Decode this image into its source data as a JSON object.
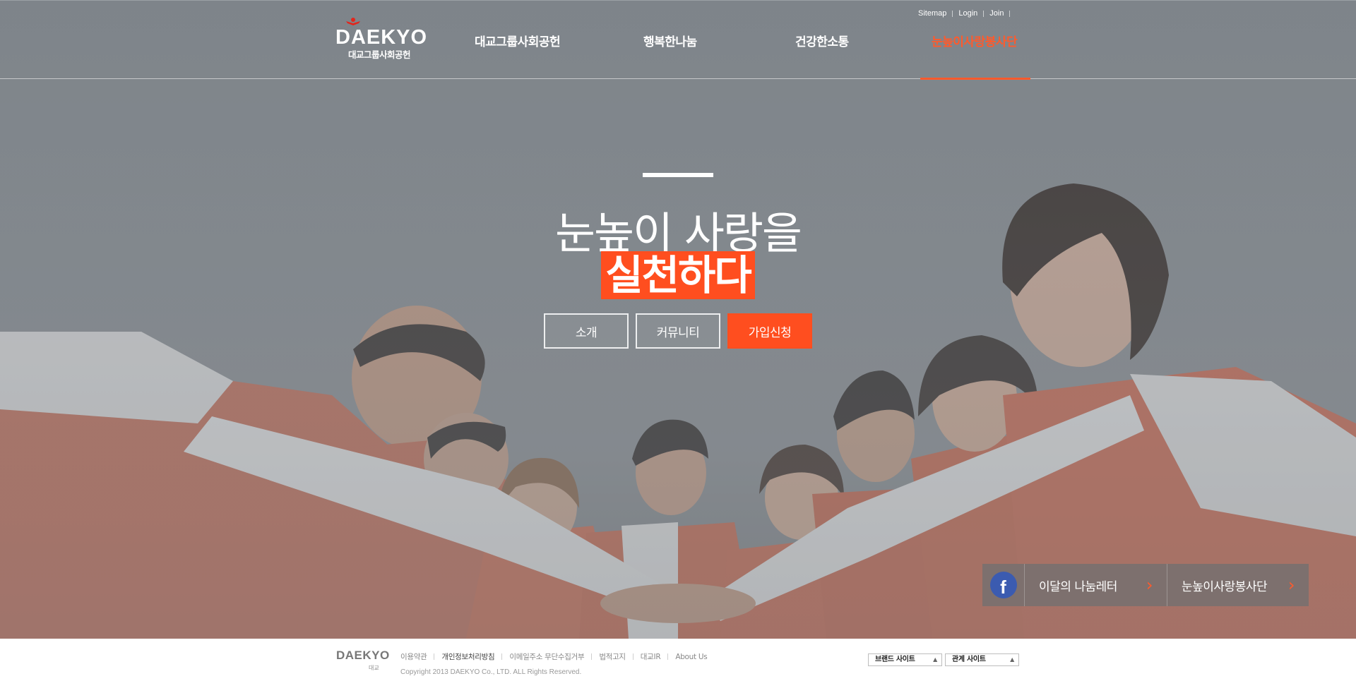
{
  "header": {
    "logo_text": "DAEKYO",
    "logo_sub": "대교그룹사회공헌",
    "util_links": [
      "Sitemap",
      "Login",
      "Join"
    ],
    "nav": [
      "대교그룹사회공헌",
      "행복한나눔",
      "건강한소통",
      "눈높이사랑봉사단"
    ],
    "active_nav_index": 3
  },
  "hero": {
    "title_line1": "눈높이 사랑을",
    "title_line2": "실천하다",
    "buttons": [
      "소개",
      "커뮤니티",
      "가입신청"
    ]
  },
  "promo": {
    "facebook_icon": "facebook-icon",
    "items": [
      "이달의 나눔레터",
      "눈높이사랑봉사단"
    ],
    "arrow_glyph": "›"
  },
  "footer": {
    "logo_text": "DAEKYO",
    "logo_sub": "대교",
    "links": [
      "이용약관",
      "개인정보처리방침",
      "이메일주소 무단수집거부",
      "법적고지",
      "대교IR",
      "About Us"
    ],
    "copyright": "Copyright 2013 DAEKYO Co., LTD. ALL Rights Reserved.",
    "selects": [
      "브랜드 사이트",
      "관계 사이트"
    ]
  },
  "colors": {
    "accent": "#ff4e1f",
    "header_bg": "#7f858b",
    "vest": "#d9593a"
  }
}
